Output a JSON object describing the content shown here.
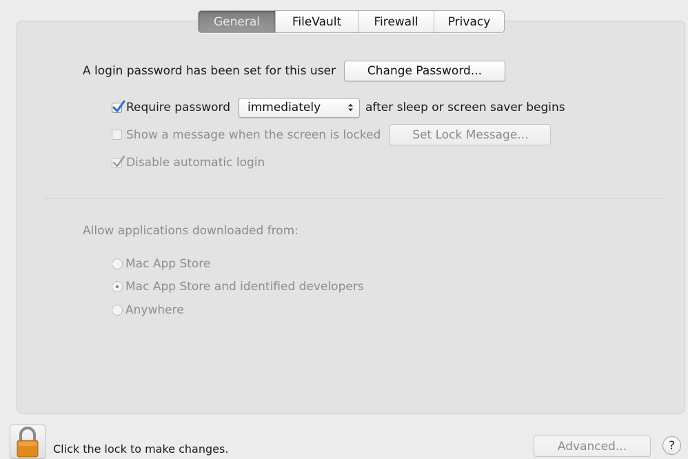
{
  "tabs": [
    {
      "label": "General",
      "active": true
    },
    {
      "label": "FileVault",
      "active": false
    },
    {
      "label": "Firewall",
      "active": false
    },
    {
      "label": "Privacy",
      "active": false
    }
  ],
  "password": {
    "status_text": "A login password has been set for this user",
    "change_button": "Change Password..."
  },
  "require_password": {
    "checked": true,
    "label": "Require password",
    "select_value": "immediately",
    "suffix": "after sleep or screen saver begins"
  },
  "lock_message": {
    "checked": false,
    "label": "Show a message when the screen is locked",
    "button": "Set Lock Message..."
  },
  "auto_login": {
    "checked": true,
    "label": "Disable automatic login"
  },
  "downloads": {
    "heading": "Allow applications downloaded from:",
    "options": [
      {
        "label": "Mac App Store",
        "selected": false
      },
      {
        "label": "Mac App Store and identified developers",
        "selected": true
      },
      {
        "label": "Anywhere",
        "selected": false
      }
    ]
  },
  "footer": {
    "lock_text": "Click the lock to make changes.",
    "advanced_button": "Advanced...",
    "help_glyph": "?"
  },
  "icons": {
    "checkmark": "checkmark-icon",
    "stepper": "up-down-arrows-icon",
    "lock": "padlock-icon",
    "help": "question-mark-icon"
  },
  "colors": {
    "lock_orange": "#e08a1e",
    "checkmark_active": "#2a6fd1",
    "checkmark_disabled": "#9a9a9a"
  }
}
